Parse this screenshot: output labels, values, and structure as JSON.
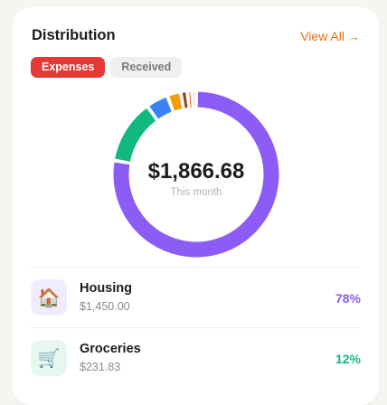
{
  "header": {
    "title": "Distribution",
    "view_all_label": "View All",
    "view_all_arrow": "→"
  },
  "tabs": [
    {
      "label": "Expenses",
      "active": true
    },
    {
      "label": "Received",
      "active": false
    }
  ],
  "total": {
    "amount": "$1,866.68",
    "caption": "This month"
  },
  "chart_data": {
    "type": "pie",
    "style": "donut",
    "segments": [
      {
        "value": 77.7,
        "color": "#8b5cf6"
      },
      {
        "value": 12.4,
        "color": "#10b981"
      },
      {
        "value": 4.3,
        "color": "#3b82f6"
      },
      {
        "value": 2.6,
        "color": "#f59e0b"
      },
      {
        "value": 1.3,
        "color": "#92400e"
      },
      {
        "value": 0.9,
        "color": "#ea580c"
      },
      {
        "value": 0.8,
        "color": "#f59e0b"
      }
    ]
  },
  "categories": [
    {
      "name": "Housing",
      "amount": "$1,450.00",
      "percent": "78%",
      "icon": "house-icon",
      "glyph": "🏠",
      "icon_bg": "#f1ecfd",
      "color": "#8b5cf6"
    },
    {
      "name": "Groceries",
      "amount": "$231.83",
      "percent": "12%",
      "icon": "cart-icon",
      "glyph": "🛒",
      "icon_bg": "#e6f7ef",
      "color": "#10b981"
    }
  ]
}
